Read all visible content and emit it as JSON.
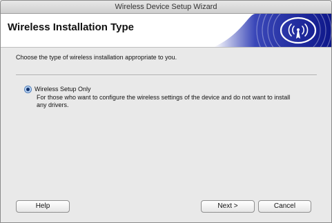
{
  "window": {
    "title": "Wireless Device Setup Wizard"
  },
  "banner": {
    "title": "Wireless Installation Type",
    "logo_icon": "wireless-signal-icon"
  },
  "main": {
    "prompt": "Choose the type of wireless installation appropriate to you.",
    "option": {
      "label": "Wireless Setup Only",
      "selected": true,
      "description": "For those who want to configure the wireless settings of the device and do not want to install any drivers."
    }
  },
  "buttons": {
    "help": "Help",
    "next": "Next >",
    "cancel": "Cancel"
  },
  "colors": {
    "banner_blue": "#1f2b9c",
    "radio_accent": "#4a7ab8"
  }
}
